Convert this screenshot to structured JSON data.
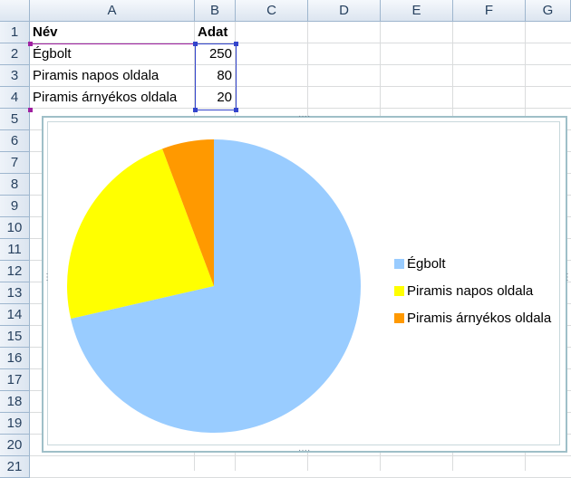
{
  "columns": [
    "A",
    "B",
    "C",
    "D",
    "E",
    "F",
    "G"
  ],
  "rows": [
    "1",
    "2",
    "3",
    "4",
    "5",
    "6",
    "7",
    "8",
    "9",
    "10",
    "11",
    "12",
    "13",
    "14",
    "15",
    "16",
    "17",
    "18",
    "19",
    "20",
    "21"
  ],
  "table": {
    "header": {
      "name": "Név",
      "value": "Adat"
    },
    "rows": [
      {
        "name": "Égbolt",
        "value": "250"
      },
      {
        "name": "Piramis napos oldala",
        "value": "80"
      },
      {
        "name": "Piramis árnyékos oldala",
        "value": "20"
      }
    ]
  },
  "chart_data": {
    "type": "pie",
    "categories": [
      "Égbolt",
      "Piramis napos oldala",
      "Piramis árnyékos oldala"
    ],
    "values": [
      250,
      80,
      20
    ],
    "colors": [
      "#99ccff",
      "#ffff00",
      "#ff9900"
    ],
    "title": "",
    "legend_position": "right"
  }
}
